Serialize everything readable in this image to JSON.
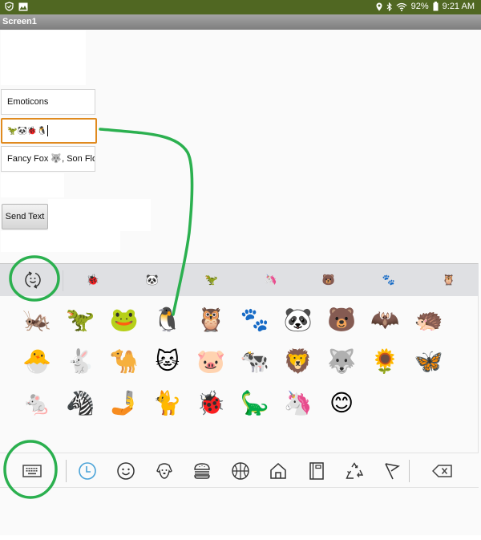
{
  "status_bar": {
    "left_icons": [
      "shield-check-icon",
      "gallery-icon"
    ],
    "battery": "92%",
    "time": "9:21 AM",
    "right_icons": [
      "location-icon",
      "bluetooth-icon",
      "wifi-icon",
      "battery-icon"
    ]
  },
  "title_bar": {
    "title": "Screen1"
  },
  "form": {
    "textbox1": {
      "value": "Emoticons"
    },
    "textbox2": {
      "value": "🦖🐼🐞🐧"
    },
    "textbox3": {
      "value": "Fancy Fox 🐺, Son Flor"
    },
    "send_button": {
      "label": "Send Text"
    }
  },
  "emoji_keyboard": {
    "recent_toggle_icon": "emoji-cycle-icon",
    "recent": [
      {
        "emoji": "🐞",
        "name": "ladybug"
      },
      {
        "emoji": "🐼",
        "name": "panda"
      },
      {
        "emoji": "🦖",
        "name": "t-rex"
      },
      {
        "emoji": "🦄",
        "name": "unicorn"
      },
      {
        "emoji": "🐻",
        "name": "bear"
      },
      {
        "emoji": "🐾",
        "name": "paw-prints"
      },
      {
        "emoji": "🦉",
        "name": "owl"
      }
    ],
    "grid": [
      {
        "emoji": "🦗",
        "name": "cricket"
      },
      {
        "emoji": "🦖",
        "name": "t-rex"
      },
      {
        "emoji": "🐸",
        "name": "frog"
      },
      {
        "emoji": "🐧",
        "name": "penguin"
      },
      {
        "emoji": "🦉",
        "name": "owl"
      },
      {
        "emoji": "🐾",
        "name": "paw-prints"
      },
      {
        "emoji": "🐼",
        "name": "panda"
      },
      {
        "emoji": "🐻",
        "name": "bear"
      },
      {
        "emoji": "🦇",
        "name": "bat"
      },
      {
        "emoji": "🦔",
        "name": "hedgehog"
      },
      {
        "emoji": "🐣",
        "name": "hatching-chick"
      },
      {
        "emoji": "🐇",
        "name": "rabbit"
      },
      {
        "emoji": "🐪",
        "name": "camel"
      },
      {
        "emoji": "🐱",
        "name": "cat-face"
      },
      {
        "emoji": "🐷",
        "name": "pig-face"
      },
      {
        "emoji": "🐄",
        "name": "cow"
      },
      {
        "emoji": "🦁",
        "name": "lion"
      },
      {
        "emoji": "🐺",
        "name": "wolf"
      },
      {
        "emoji": "🌻",
        "name": "sunflower"
      },
      {
        "emoji": "🦋",
        "name": "butterfly"
      },
      {
        "emoji": "🐁",
        "name": "mouse"
      },
      {
        "emoji": "🦓",
        "name": "zebra"
      },
      {
        "emoji": "🤳",
        "name": "selfie"
      },
      {
        "emoji": "🐈",
        "name": "cat"
      },
      {
        "emoji": "🐞",
        "name": "ladybug"
      },
      {
        "emoji": "🦕",
        "name": "sauropod"
      },
      {
        "emoji": "🦄",
        "name": "unicorn"
      },
      {
        "emoji": "😊",
        "name": "smiling-face"
      }
    ],
    "categories": [
      {
        "name": "keyboard",
        "icon": "keyboard-icon"
      },
      {
        "name": "recent",
        "icon": "clock-icon",
        "active": true
      },
      {
        "name": "smileys",
        "icon": "smiley-icon"
      },
      {
        "name": "animals",
        "icon": "dog-icon"
      },
      {
        "name": "food",
        "icon": "burger-icon"
      },
      {
        "name": "activity",
        "icon": "ball-icon"
      },
      {
        "name": "places",
        "icon": "house-icon"
      },
      {
        "name": "objects",
        "icon": "notebook-icon"
      },
      {
        "name": "symbols",
        "icon": "recycle-icon"
      },
      {
        "name": "flags",
        "icon": "flag-icon"
      },
      {
        "name": "backspace",
        "icon": "backspace-icon"
      }
    ],
    "accent_color": "#4aa3d8"
  },
  "annotations": {
    "color": "#2bb04f"
  }
}
